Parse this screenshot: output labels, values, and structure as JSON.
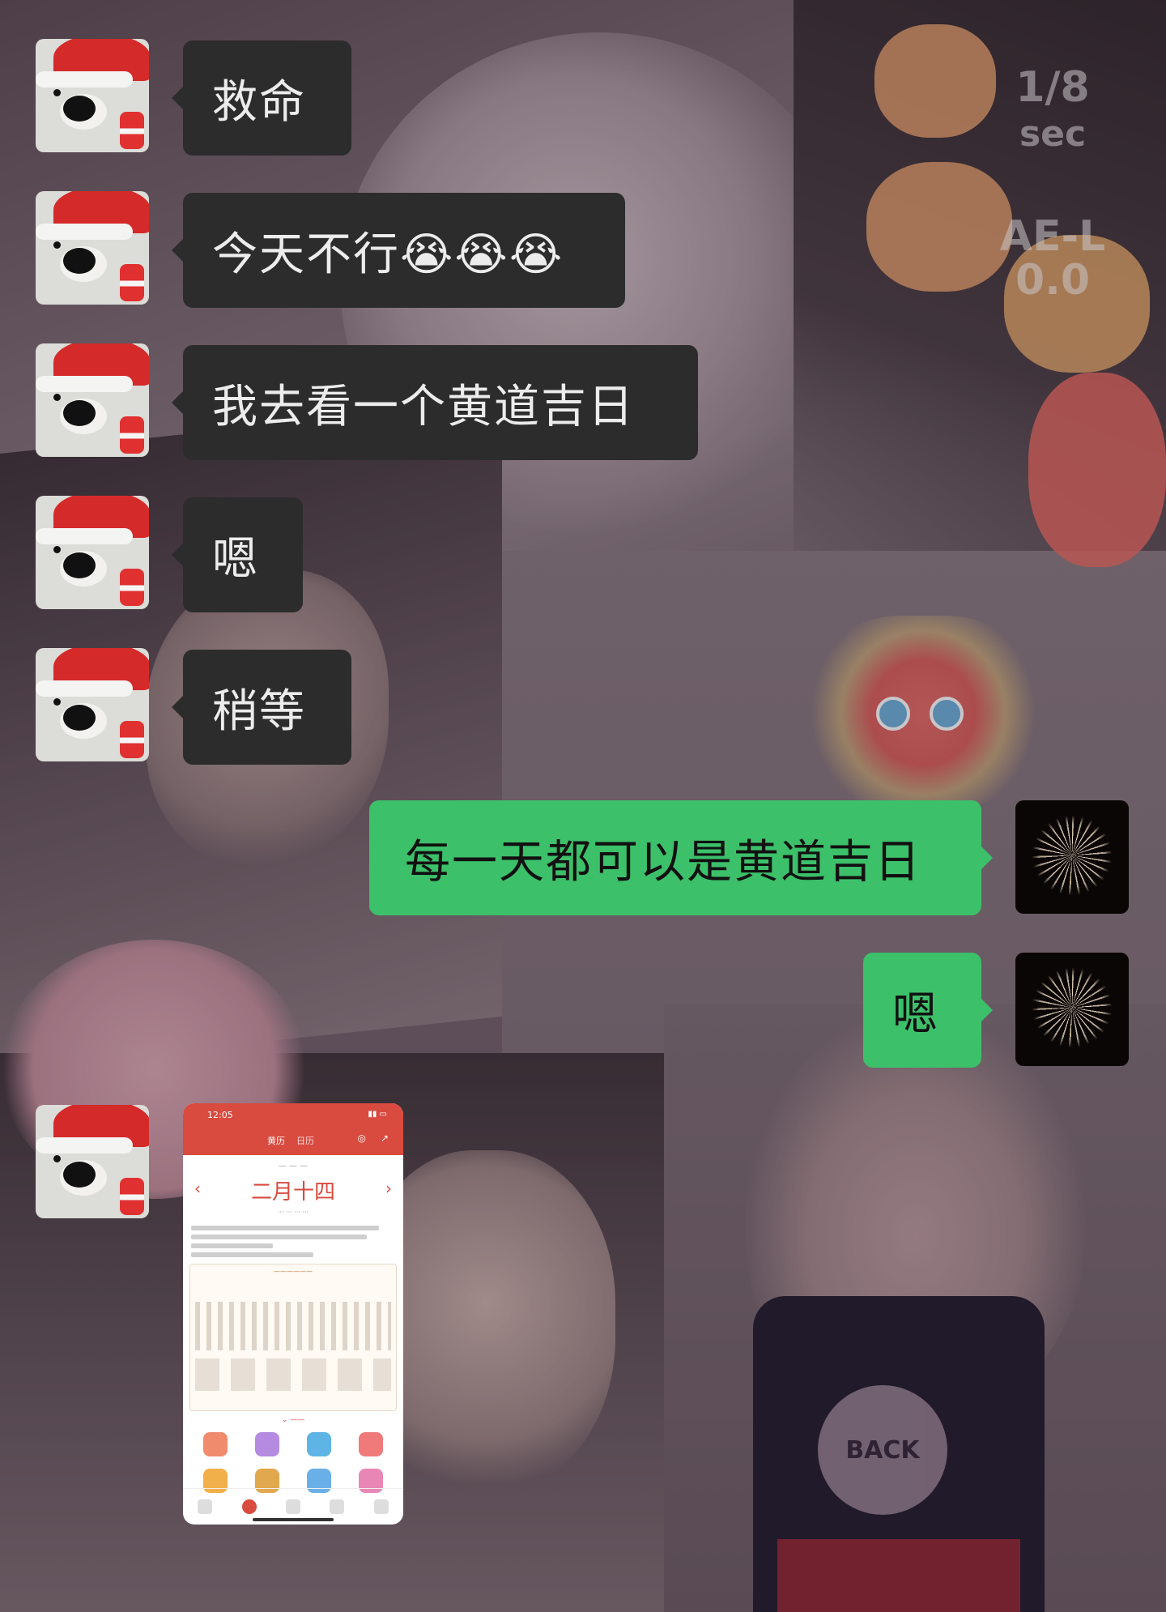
{
  "wallpaper": {
    "camera_overlay": {
      "shutter": "1/8",
      "shutter_unit": "sec",
      "ae_lock": "AE-L",
      "exposure": "0.0"
    },
    "shirt_text": "BACK"
  },
  "messages": [
    {
      "side": "in",
      "sender": "dog-avatar",
      "text": "救命"
    },
    {
      "side": "in",
      "sender": "dog-avatar",
      "text": "今天不行😭😭😭"
    },
    {
      "side": "in",
      "sender": "dog-avatar",
      "text": "我去看一个黄道吉日"
    },
    {
      "side": "in",
      "sender": "dog-avatar",
      "text": "嗯"
    },
    {
      "side": "in",
      "sender": "dog-avatar",
      "text": "稍等"
    },
    {
      "side": "out",
      "sender": "fireworks-avatar",
      "text": "每一天都可以是黄道吉日"
    },
    {
      "side": "out",
      "sender": "fireworks-avatar",
      "text": "嗯"
    },
    {
      "side": "in",
      "sender": "dog-avatar",
      "type": "image"
    }
  ],
  "calendar_screenshot": {
    "status_time": "12:05",
    "tabs": [
      "黄历",
      "日历"
    ],
    "lunar_date": "二月十四",
    "prev": "‹",
    "next": "›"
  },
  "colors": {
    "incoming_bubble": "#2c2c2c",
    "outgoing_bubble": "#3cc06a",
    "calendar_accent": "#d94a3f"
  }
}
